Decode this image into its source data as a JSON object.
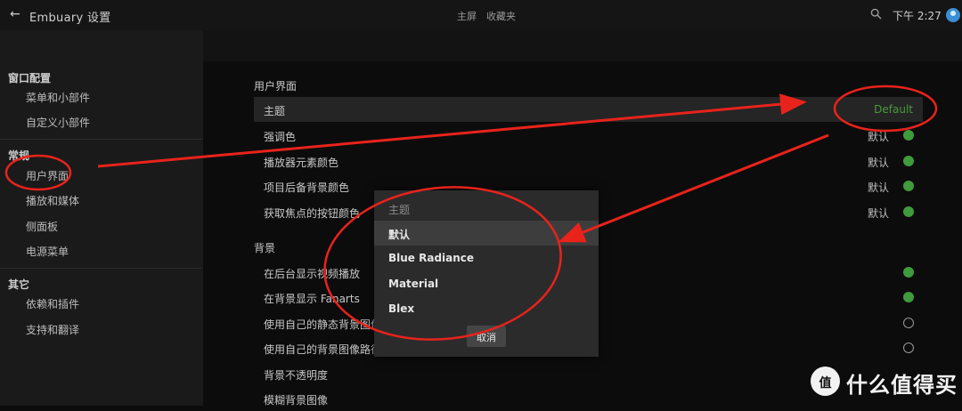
{
  "header": {
    "back_icon": "arrow-left-icon",
    "title": "Embuary 设置",
    "tabs": [
      "主屏",
      "收藏夹"
    ],
    "time": "下午 2:27",
    "search_icon": "search-icon"
  },
  "sidebar": {
    "sections": [
      {
        "title": "窗口配置",
        "items": [
          "菜单和小部件",
          "自定义小部件"
        ]
      },
      {
        "title": "常规",
        "items": [
          "用户界面",
          "播放和媒体",
          "侧面板",
          "电源菜单"
        ]
      },
      {
        "title": "其它",
        "items": [
          "依赖和插件",
          "支持和翻译"
        ]
      }
    ]
  },
  "main": {
    "ui_section": {
      "title": "用户界面",
      "rows": [
        {
          "label": "主题",
          "value": "Default"
        },
        {
          "label": "强调色",
          "value": "默认"
        },
        {
          "label": "播放器元素颜色",
          "value": "默认"
        },
        {
          "label": "项目后备背景颜色",
          "value": "默认"
        },
        {
          "label": "获取焦点的按钮颜色",
          "value": "默认"
        }
      ]
    },
    "bg_section": {
      "title": "背景",
      "rows": [
        {
          "label": "在后台显示视频播放",
          "enabled": true
        },
        {
          "label": "在背景显示 Fanarts",
          "enabled": true
        },
        {
          "label": "使用自己的静态背景图像",
          "enabled": false
        },
        {
          "label": "使用自己的背景图像路径",
          "enabled": false
        },
        {
          "label": "背景不透明度"
        },
        {
          "label": "模糊背景图像"
        }
      ]
    }
  },
  "dialog": {
    "title": "主题",
    "options": [
      "默认",
      "Blue Radiance",
      "Material",
      "Blex"
    ],
    "selected": "默认",
    "cancel_label": "取消"
  },
  "colors": {
    "accent_green": "#3f9b3c",
    "annotation_red": "#e8231b"
  },
  "watermark": {
    "badge": "值",
    "text": "什么值得买"
  }
}
